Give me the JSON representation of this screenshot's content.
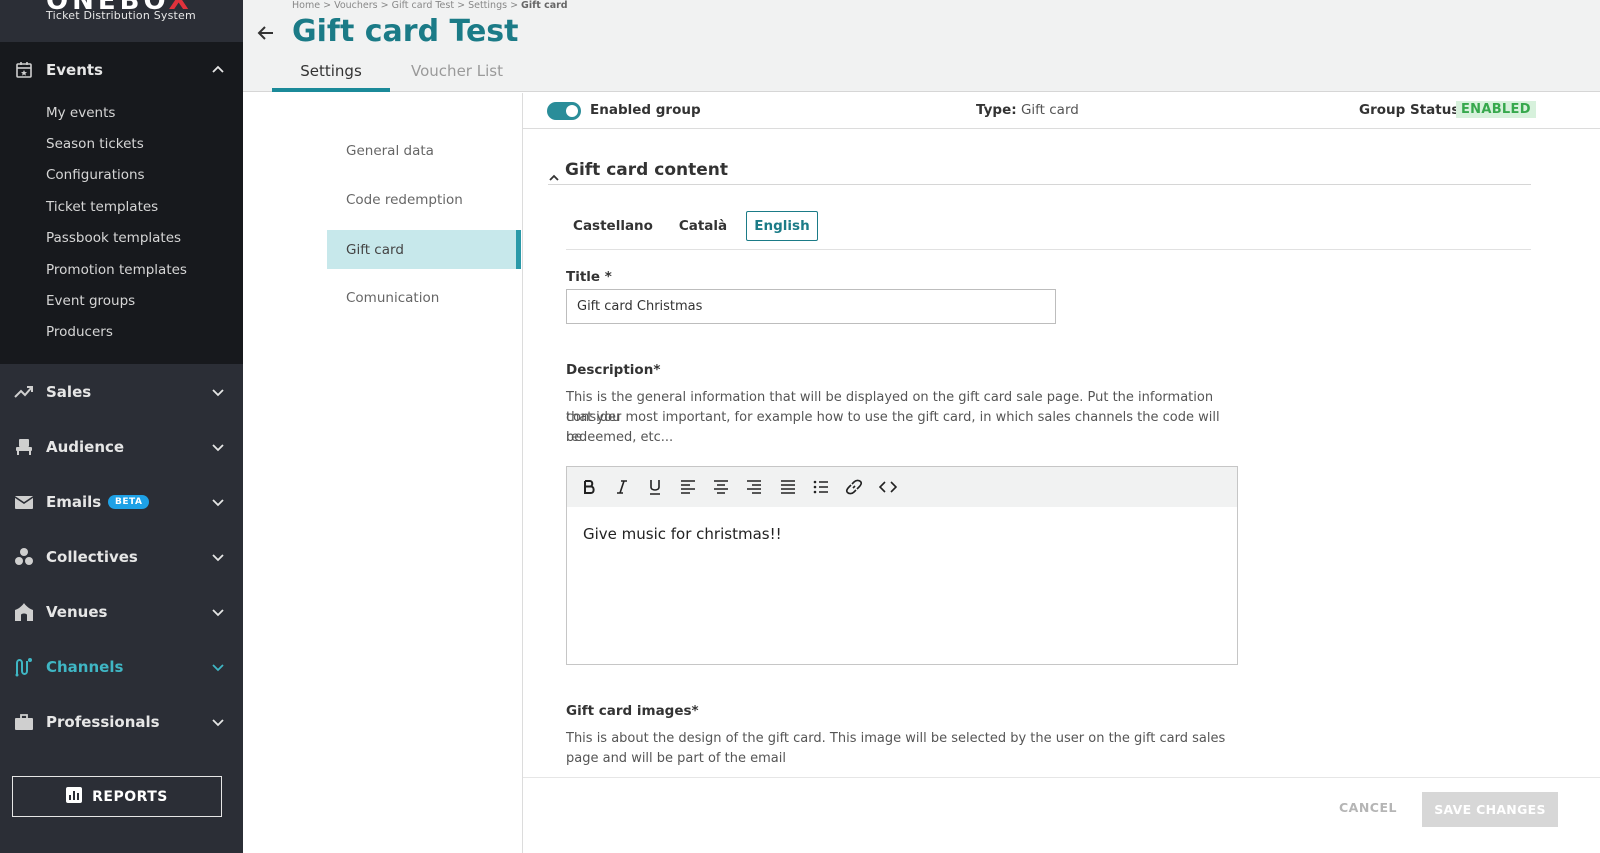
{
  "brand": {
    "logo_main": "ONEBO",
    "logo_accent": "X",
    "subtitle": "Ticket Distribution System"
  },
  "sidebar": {
    "events": {
      "label": "Events",
      "items": [
        "My events",
        "Season tickets",
        "Configurations",
        "Ticket templates",
        "Passbook templates",
        "Promotion templates",
        "Event groups",
        "Producers"
      ]
    },
    "sections": [
      {
        "label": "Sales",
        "icon": "trending-up-icon"
      },
      {
        "label": "Audience",
        "icon": "seat-icon"
      },
      {
        "label": "Emails",
        "icon": "mail-icon",
        "badge": "BETA"
      },
      {
        "label": "Collectives",
        "icon": "group-icon"
      },
      {
        "label": "Venues",
        "icon": "venue-icon"
      },
      {
        "label": "Channels",
        "icon": "channels-icon",
        "active": true
      },
      {
        "label": "Professionals",
        "icon": "briefcase-icon"
      }
    ],
    "reports_label": "REPORTS"
  },
  "header": {
    "breadcrumb": [
      "Home",
      "Vouchers",
      "Gift card Test",
      "Settings",
      "Gift card"
    ],
    "title": "Gift card Test",
    "tabs": [
      "Settings",
      "Voucher List"
    ]
  },
  "settings_menu": [
    "General data",
    "Code redemption",
    "Gift card",
    "Comunication"
  ],
  "infobar": {
    "enabled_label": "Enabled group",
    "type_label": "Type:",
    "type_value": "Gift card",
    "status_label": "Group Status:",
    "status_value": "ENABLED"
  },
  "content": {
    "section_title": "Gift card content",
    "languages": [
      "Castellano",
      "Català",
      "English"
    ],
    "active_language": "English",
    "title_label": "Title *",
    "title_value": "Gift card Christmas",
    "description_label": "Description*",
    "description_help_1": "This is the general information that will be displayed on the gift card sale page. Put the information that you",
    "description_help_2": "consider most important, for example how to use the gift card, in which sales channels the code will be",
    "description_help_3": "redeemed, etc...",
    "editor_text": "Give music for christmas!!",
    "images_label": "Gift card images*",
    "images_help_1": "This is about the design of the gift card. This image will be selected by the user on the gift card sales",
    "images_help_2": "page and will be part of the email"
  },
  "footer": {
    "cancel_label": "CANCEL",
    "save_label": "SAVE CHANGES"
  },
  "colors": {
    "accent": "#1b7b87",
    "sidebar_bg": "#2b2e36",
    "sidebar_dark": "#17191d",
    "active_menu_bg": "#c7e8eb",
    "status_green": "#36a84c"
  }
}
